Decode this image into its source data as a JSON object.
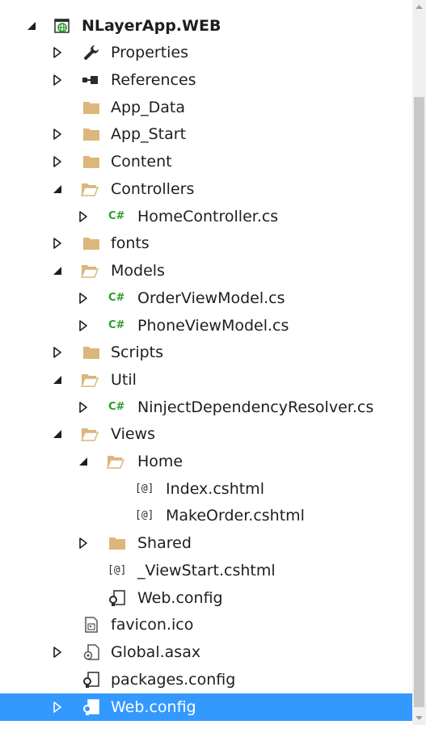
{
  "tree": {
    "project": {
      "label": "NLayerApp.WEB",
      "icon": "web-project-icon",
      "state": "expanded"
    },
    "properties": {
      "label": "Properties",
      "icon": "wrench-icon",
      "state": "collapsed"
    },
    "references": {
      "label": "References",
      "icon": "references-icon",
      "state": "collapsed"
    },
    "app_data": {
      "label": "App_Data",
      "icon": "folder-icon"
    },
    "app_start": {
      "label": "App_Start",
      "icon": "folder-icon",
      "state": "collapsed"
    },
    "content": {
      "label": "Content",
      "icon": "folder-icon",
      "state": "collapsed"
    },
    "controllers": {
      "label": "Controllers",
      "icon": "folder-open-icon",
      "state": "expanded"
    },
    "home_controller": {
      "label": "HomeController.cs",
      "icon_text": "C#",
      "state": "collapsed"
    },
    "fonts": {
      "label": "fonts",
      "icon": "folder-icon",
      "state": "collapsed"
    },
    "models": {
      "label": "Models",
      "icon": "folder-open-icon",
      "state": "expanded"
    },
    "order_view_model": {
      "label": "OrderViewModel.cs",
      "icon_text": "C#",
      "state": "collapsed"
    },
    "phone_view_model": {
      "label": "PhoneViewModel.cs",
      "icon_text": "C#",
      "state": "collapsed"
    },
    "scripts": {
      "label": "Scripts",
      "icon": "folder-icon",
      "state": "collapsed"
    },
    "util": {
      "label": "Util",
      "icon": "folder-open-icon",
      "state": "expanded"
    },
    "ninject_resolver": {
      "label": "NinjectDependencyResolver.cs",
      "icon_text": "C#",
      "state": "collapsed"
    },
    "views": {
      "label": "Views",
      "icon": "folder-open-icon",
      "state": "expanded"
    },
    "home": {
      "label": "Home",
      "icon": "folder-open-icon",
      "state": "expanded"
    },
    "index_cshtml": {
      "label": "Index.cshtml",
      "icon_text": "[@]"
    },
    "make_order_cshtml": {
      "label": "MakeOrder.cshtml",
      "icon_text": "[@]"
    },
    "shared": {
      "label": "Shared",
      "icon": "folder-icon",
      "state": "collapsed"
    },
    "view_start": {
      "label": "_ViewStart.cshtml",
      "icon_text": "[@]"
    },
    "views_web_config": {
      "label": "Web.config",
      "icon": "config-icon"
    },
    "favicon": {
      "label": "favicon.ico",
      "icon": "image-file-icon"
    },
    "global_asax": {
      "label": "Global.asax",
      "icon": "global-asax-icon",
      "state": "collapsed"
    },
    "packages_config": {
      "label": "packages.config",
      "icon": "config-icon"
    },
    "web_config": {
      "label": "Web.config",
      "icon": "config-icon",
      "state": "collapsed",
      "selected": true
    }
  },
  "colors": {
    "selection": "#3399ff",
    "folder": "#dcb67a",
    "csharp": "#2a9d2a",
    "text": "#1e1e1e"
  }
}
